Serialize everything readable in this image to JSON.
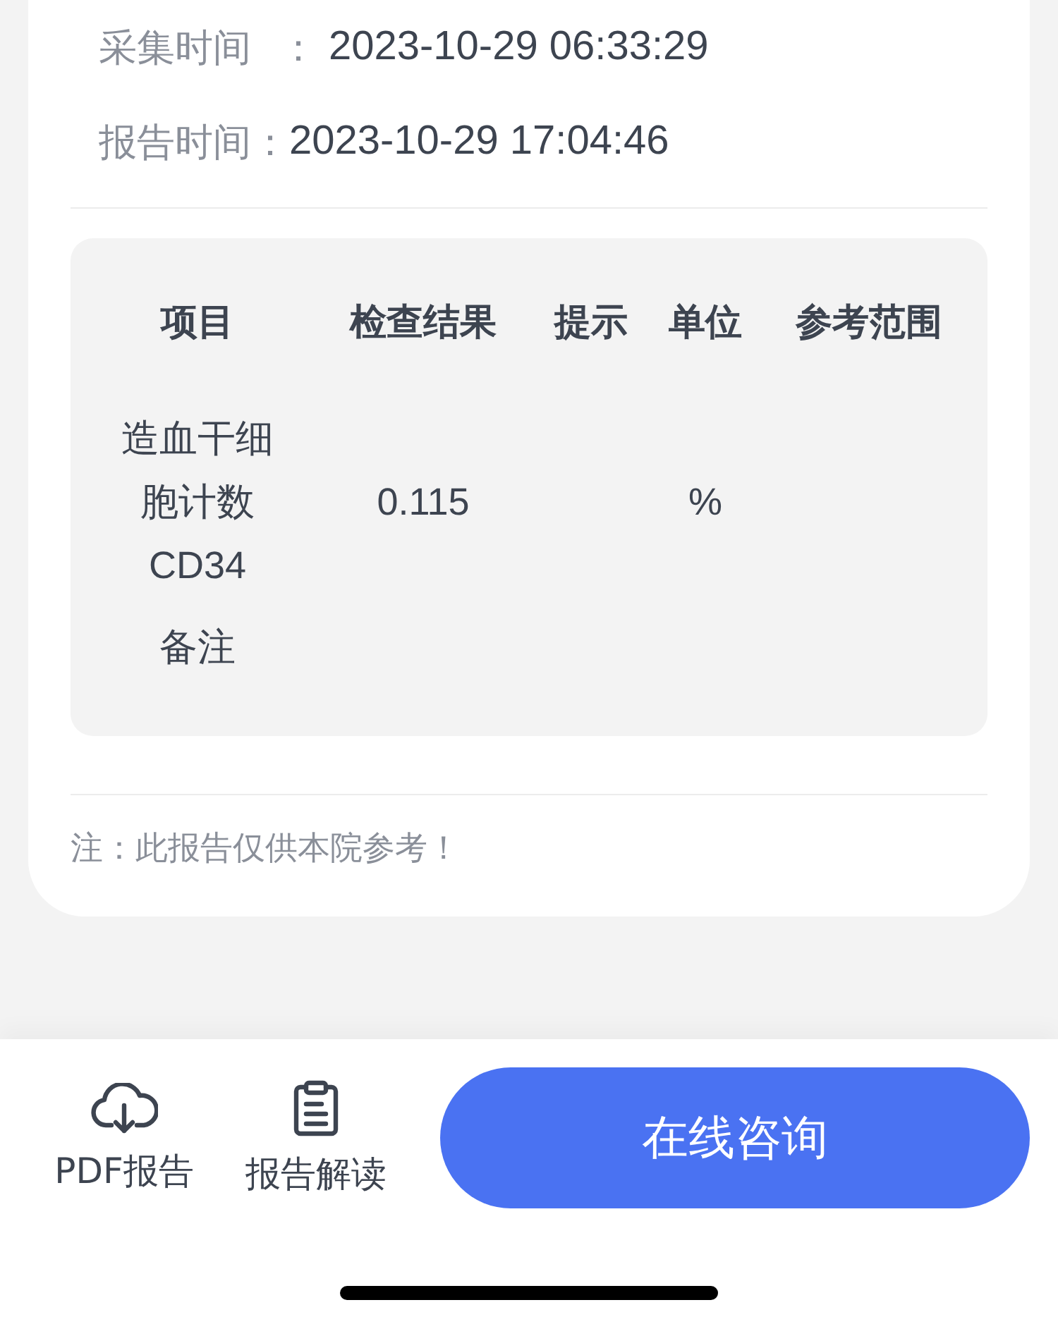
{
  "info": [
    {
      "label": "采集时间",
      "separator": "：",
      "value": "2023-10-29 06:33:29"
    },
    {
      "label": "报告时间：",
      "value": "2023-10-29 17:04:46"
    }
  ],
  "table": {
    "columns": [
      "项目",
      "检查结果",
      "提示",
      "单位",
      "参考范围"
    ],
    "rows": [
      {
        "cells": [
          "造血干细胞计数CD34",
          "0.115",
          "",
          "%",
          ""
        ]
      },
      {
        "cells": [
          "备注",
          "",
          "",
          "",
          ""
        ]
      }
    ]
  },
  "note": "注：此报告仅供本院参考！",
  "bottom_bar": {
    "actions": [
      {
        "kind": "download",
        "label": "PDF报告"
      },
      {
        "kind": "clipboard",
        "label": "报告解读"
      }
    ],
    "primary_button": "在线咨询"
  }
}
